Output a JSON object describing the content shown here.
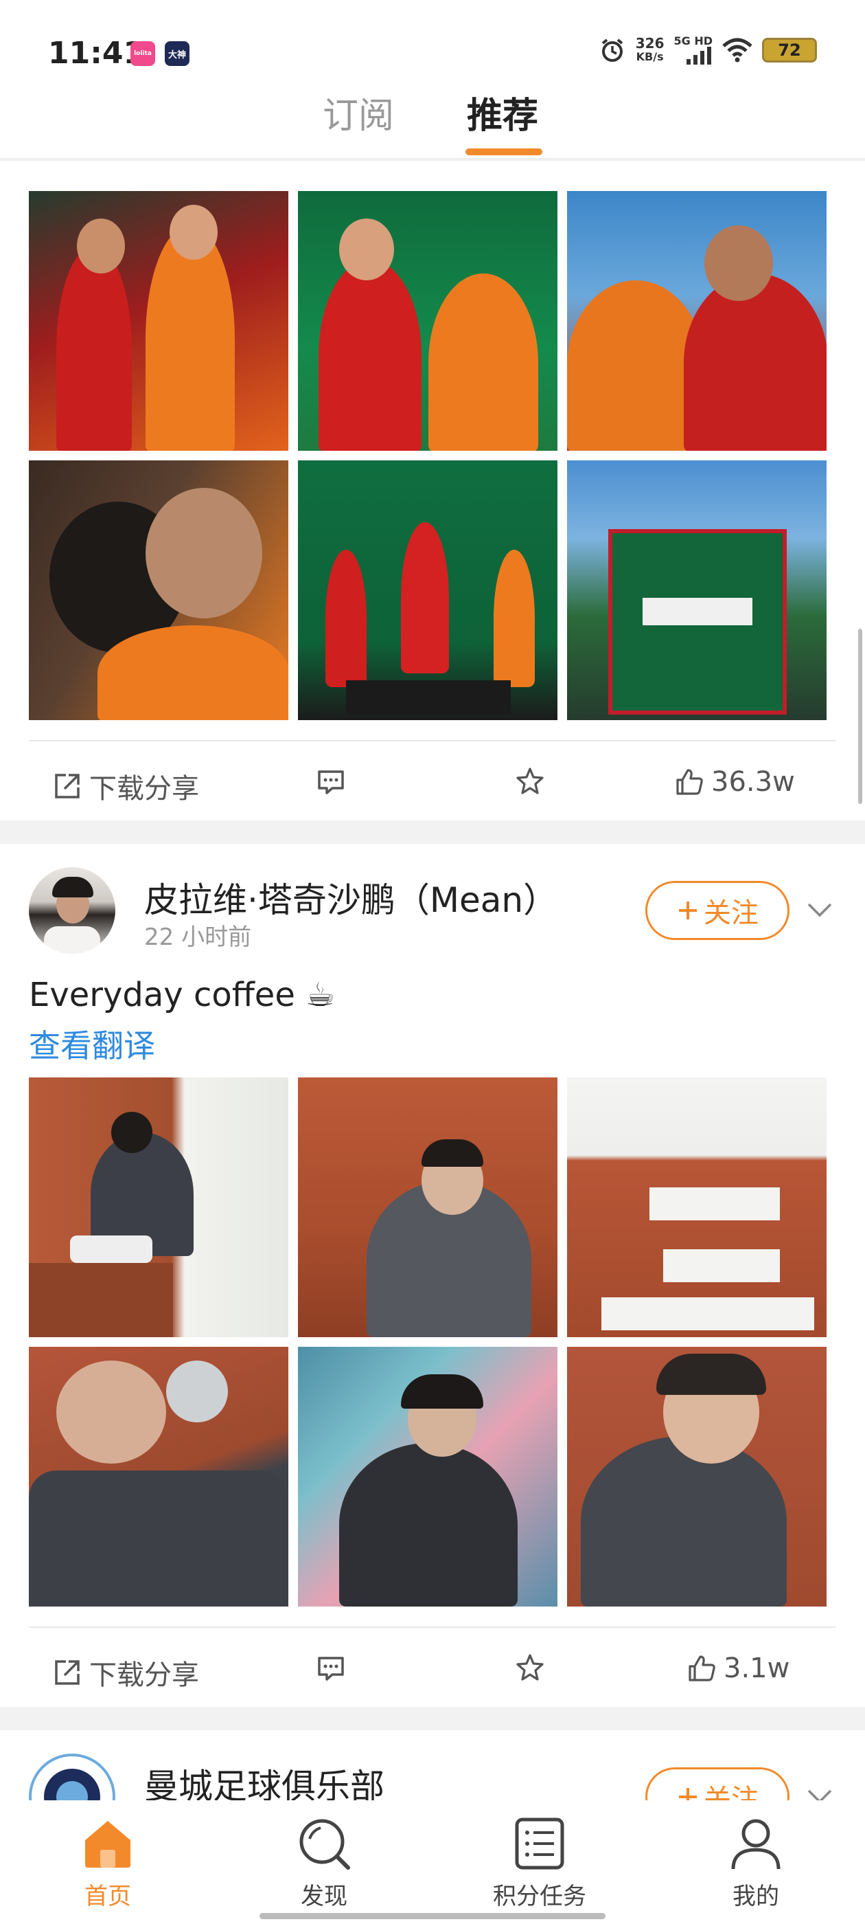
{
  "status_bar": {
    "time": "11:41",
    "badge1": "lolita",
    "badge2": "大神",
    "net_speed_value": "326",
    "net_speed_unit": "KB/s",
    "net_type": "5G HD",
    "battery": "72"
  },
  "header": {
    "tabs": [
      {
        "label": "订阅",
        "active": false
      },
      {
        "label": "推荐",
        "active": true
      }
    ],
    "accent_color": "#f28a2b"
  },
  "post1": {
    "actions": {
      "share_label": "下载分享",
      "like_count": "36.3w"
    }
  },
  "post2": {
    "user_name": "皮拉维·塔奇沙鹏（Mean）",
    "time": "22 小时前",
    "follow_label": "关注",
    "text": "Everyday coffee ☕",
    "translate_label": "查看翻译",
    "actions": {
      "share_label": "下载分享",
      "like_count": "3.1w"
    }
  },
  "post3": {
    "user_name": "曼城足球俱乐部",
    "follow_label": "关注"
  },
  "bottom_nav": {
    "items": [
      {
        "label": "首页",
        "icon": "home-icon",
        "active": true
      },
      {
        "label": "发现",
        "icon": "discover-icon",
        "active": false
      },
      {
        "label": "积分任务",
        "icon": "tasks-icon",
        "active": false
      },
      {
        "label": "我的",
        "icon": "profile-icon",
        "active": false
      }
    ]
  }
}
